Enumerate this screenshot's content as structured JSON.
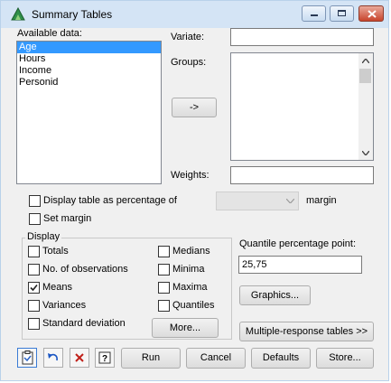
{
  "window": {
    "title": "Summary Tables"
  },
  "available": {
    "label": "Available data:",
    "items": [
      "Age",
      "Hours",
      "Income",
      "Personid"
    ],
    "selected_index": 0
  },
  "variate": {
    "label": "Variate:",
    "value": ""
  },
  "groups": {
    "label": "Groups:"
  },
  "arrow_button": {
    "label": "->"
  },
  "weights": {
    "label": "Weights:",
    "value": ""
  },
  "percentage": {
    "label": "Display table as percentage of",
    "dropdown_value": "",
    "suffix": "margin"
  },
  "set_margin": {
    "label": "Set margin"
  },
  "display": {
    "title": "Display",
    "left": [
      {
        "label": "Totals",
        "checked": false
      },
      {
        "label": "No. of observations",
        "checked": false
      },
      {
        "label": "Means",
        "checked": true
      },
      {
        "label": "Variances",
        "checked": false
      },
      {
        "label": "Standard deviation",
        "checked": false
      }
    ],
    "right": [
      {
        "label": "Medians",
        "checked": false
      },
      {
        "label": "Minima",
        "checked": false
      },
      {
        "label": "Maxima",
        "checked": false
      },
      {
        "label": "Quantiles",
        "checked": false
      }
    ],
    "more_label": "More..."
  },
  "quantile": {
    "label": "Quantile percentage point:",
    "value": "25,75"
  },
  "graphics_label": "Graphics...",
  "multiple_response_label": "Multiple-response tables >>",
  "footer": {
    "run": "Run",
    "cancel": "Cancel",
    "defaults": "Defaults",
    "store": "Store..."
  }
}
